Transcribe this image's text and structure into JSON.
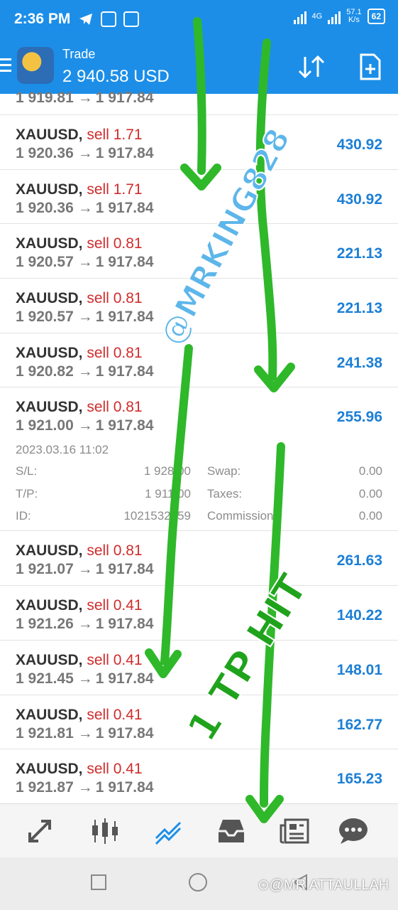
{
  "status_bar": {
    "time": "2:36 PM",
    "network": "4G",
    "speed": "57.1",
    "speed_unit": "K/s",
    "battery": "62"
  },
  "header": {
    "title": "Trade",
    "balance": "2 940.58 USD"
  },
  "positions": [
    {
      "symbol": "XAUUSD,",
      "side": "sell",
      "volume": "1.71",
      "open": "1 920.36",
      "current": "1 917.84",
      "profit": "430.92"
    },
    {
      "symbol": "XAUUSD,",
      "side": "sell",
      "volume": "1.71",
      "open": "1 920.36",
      "current": "1 917.84",
      "profit": "430.92"
    },
    {
      "symbol": "XAUUSD,",
      "side": "sell",
      "volume": "0.81",
      "open": "1 920.57",
      "current": "1 917.84",
      "profit": "221.13"
    },
    {
      "symbol": "XAUUSD,",
      "side": "sell",
      "volume": "0.81",
      "open": "1 920.57",
      "current": "1 917.84",
      "profit": "221.13"
    },
    {
      "symbol": "XAUUSD,",
      "side": "sell",
      "volume": "0.81",
      "open": "1 920.82",
      "current": "1 917.84",
      "profit": "241.38"
    },
    {
      "symbol": "XAUUSD,",
      "side": "sell",
      "volume": "0.81",
      "open": "1 921.00",
      "current": "1 917.84",
      "profit": "255.96"
    },
    {
      "symbol": "XAUUSD,",
      "side": "sell",
      "volume": "0.81",
      "open": "1 921.07",
      "current": "1 917.84",
      "profit": "261.63"
    },
    {
      "symbol": "XAUUSD,",
      "side": "sell",
      "volume": "0.41",
      "open": "1 921.26",
      "current": "1 917.84",
      "profit": "140.22"
    },
    {
      "symbol": "XAUUSD,",
      "side": "sell",
      "volume": "0.41",
      "open": "1 921.45",
      "current": "1 917.84",
      "profit": "148.01"
    },
    {
      "symbol": "XAUUSD,",
      "side": "sell",
      "volume": "0.41",
      "open": "1 921.81",
      "current": "1 917.84",
      "profit": "162.77"
    },
    {
      "symbol": "XAUUSD,",
      "side": "sell",
      "volume": "0.41",
      "open": "1 921.87",
      "current": "1 917.84",
      "profit": "165.23"
    }
  ],
  "clipped_row": {
    "open": "1 919.81",
    "current": "1 917.84"
  },
  "arrow_glyph": "→",
  "expanded_detail": {
    "date": "2023.03.16 11:02",
    "sl_label": "S/L:",
    "sl_value": "1 928.00",
    "tp_label": "T/P:",
    "tp_value": "1 911.00",
    "id_label": "ID:",
    "id_value": "1021532959",
    "swap_label": "Swap:",
    "swap_value": "0.00",
    "taxes_label": "Taxes:",
    "taxes_value": "0.00",
    "commission_label": "Commission:",
    "commission_value": "0.00"
  },
  "overlays": {
    "watermark": "@MRKING828",
    "tp_note": "1 TP HIT",
    "corner_watermark": "⊙@MR ATTAULLAH",
    "arrow_color": "#2fb82a"
  },
  "bottom_nav": [
    "quotes-icon",
    "chart-icon",
    "trade-icon",
    "history-icon",
    "news-icon",
    "chat-icon"
  ],
  "colors": {
    "header": "#1c8ee8",
    "sell": "#d12c2c",
    "profit": "#1c7fd6"
  }
}
